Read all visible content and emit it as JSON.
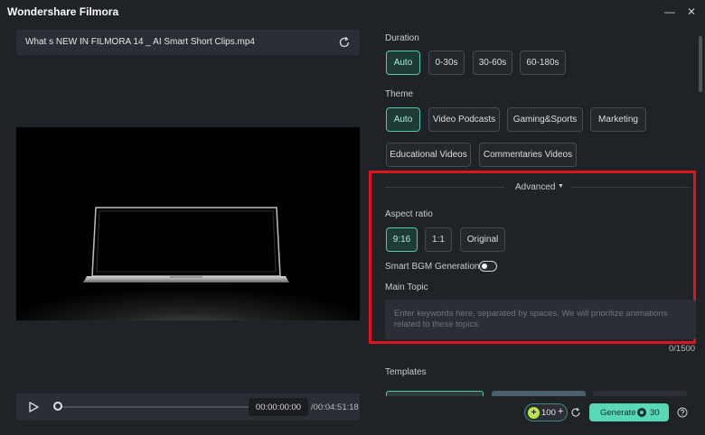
{
  "window": {
    "title": "Wondershare Filmora",
    "minimize_glyph": "—",
    "close_glyph": "✕"
  },
  "file": {
    "name": "What s NEW IN FILMORA 14 _ AI Smart Short Clips.mp4",
    "refresh_icon": "refresh-icon"
  },
  "player": {
    "current_time": "00:00:00:00",
    "total_time": "/00:04:51:18",
    "progress": 0
  },
  "duration": {
    "label": "Duration",
    "options": [
      "Auto",
      "0-30s",
      "30-60s",
      "60-180s"
    ],
    "selected": "Auto"
  },
  "theme": {
    "label": "Theme",
    "options": [
      "Auto",
      "Video Podcasts",
      "Gaming&Sports",
      "Marketing",
      "Educational Videos",
      "Commentaries Videos"
    ],
    "selected": "Auto"
  },
  "advanced": {
    "label": "Advanced",
    "caret": "▼",
    "aspect_ratio": {
      "label": "Aspect ratio",
      "options": [
        "9:16",
        "1:1",
        "Original"
      ],
      "selected": "9:16"
    },
    "smart_bgm": {
      "label": "Smart BGM Generation",
      "enabled": false
    },
    "main_topic": {
      "label": "Main Topic",
      "value": "",
      "placeholder": "Enter keywords here, separated by spaces. We will prioritize animations related to these topics.",
      "counter": "0/1500"
    },
    "highlight_color": "#e0121b"
  },
  "templates": {
    "label": "Templates"
  },
  "footer": {
    "credits": "100",
    "credits_plus": "+",
    "generate_label": "Generate",
    "generate_cost": "30"
  },
  "colors": {
    "accent": "#59d8b6",
    "background": "#1f2226",
    "panel": "#2b2f35"
  }
}
